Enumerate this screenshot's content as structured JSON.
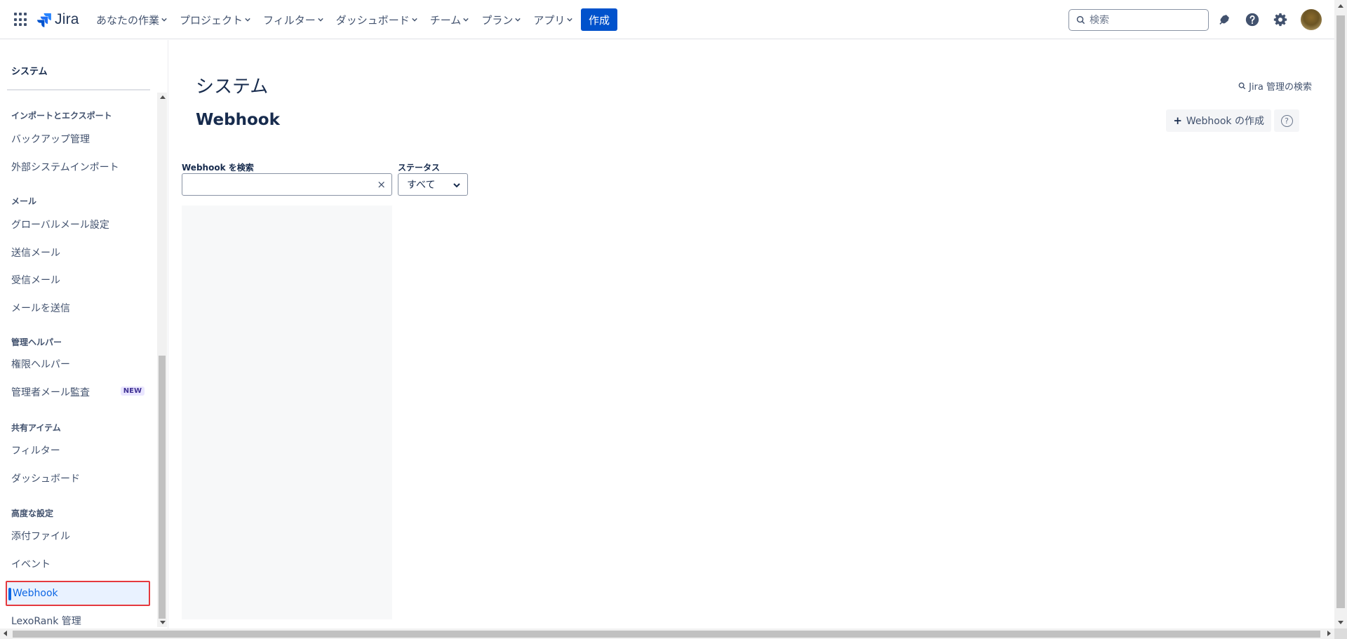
{
  "topnav": {
    "logo_text": "Jira",
    "items": [
      {
        "label": "あなたの作業"
      },
      {
        "label": "プロジェクト"
      },
      {
        "label": "フィルター"
      },
      {
        "label": "ダッシュボード"
      },
      {
        "label": "チーム"
      },
      {
        "label": "プラン"
      },
      {
        "label": "アプリ"
      }
    ],
    "create_label": "作成",
    "search_placeholder": "検索",
    "brand_color": "#0052cc",
    "icons": [
      "app-switcher-icon",
      "notification-bell-icon",
      "help-icon",
      "settings-gear-icon"
    ]
  },
  "sidebar": {
    "title": "システム",
    "sections": [
      {
        "heading": "インポートとエクスポート",
        "items": [
          "バックアップ管理",
          "外部システムインポート"
        ]
      },
      {
        "heading": "メール",
        "items": [
          "グローバルメール設定",
          "送信メール",
          "受信メール",
          "メールを送信"
        ]
      },
      {
        "heading": "管理ヘルパー",
        "items": [
          "権限ヘルパー",
          "管理者メール監査"
        ]
      },
      {
        "heading": "共有アイテム",
        "items": [
          "フィルター",
          "ダッシュボード"
        ]
      },
      {
        "heading": "高度な設定",
        "items": [
          "添付ファイル",
          "イベント",
          "Webhook",
          "LexoRank 管理"
        ]
      }
    ],
    "new_badge": "NEW",
    "active_item": "Webhook",
    "active_color": "#0c66e4",
    "highlight_color": "#e5393e"
  },
  "main": {
    "page_title": "システム",
    "admin_search": "Jira 管理の検索",
    "sub_title": "Webhook",
    "create_webhook_label": "Webhook の作成",
    "help_glyph": "?",
    "filters": {
      "search_label": "Webhook を検索",
      "search_value": "",
      "clear_glyph": "×",
      "status_label": "ステータス",
      "status_selected": "すべて"
    }
  }
}
